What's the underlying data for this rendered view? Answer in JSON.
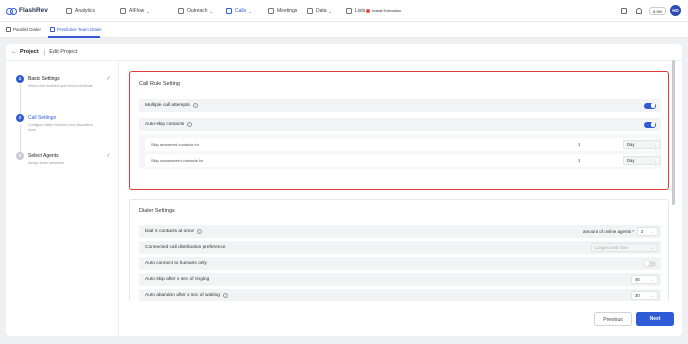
{
  "app": {
    "name": "FlashRev"
  },
  "nav": {
    "items": [
      {
        "label": "Analytics",
        "icon": "analytics-icon"
      },
      {
        "label": "AIFlow",
        "icon": "aiflow-icon"
      },
      {
        "label": "Outreach",
        "icon": "outreach-icon"
      },
      {
        "label": "Calls",
        "icon": "phone-icon"
      },
      {
        "label": "Meetings",
        "icon": "meetings-icon"
      },
      {
        "label": "Data",
        "icon": "data-icon"
      },
      {
        "label": "Lists",
        "icon": "lists-icon"
      }
    ],
    "install_label": "Install Extension",
    "balance": "8.9M",
    "avatar_initials": "HD"
  },
  "subtabs": [
    {
      "label": "Parallel Dialer"
    },
    {
      "label": "Predictive Team Dialer"
    }
  ],
  "header": {
    "back_label": "Project",
    "edit_label": "Edit Project"
  },
  "steps": [
    {
      "num": "1",
      "title": "Basic Settings",
      "desc": "Select dial numbers and select shortcuts"
    },
    {
      "num": "2",
      "title": "Call Settings",
      "desc": "Configure dialer behavior and disposition rules"
    },
    {
      "num": "3",
      "title": "Select Agents",
      "desc": "Assign team members"
    }
  ],
  "call_rule": {
    "title": "Call Rule Setting",
    "multiple_attempts_label": "Multiple call attempts",
    "multiple_attempts_on": true,
    "auto_skip_label": "Auto-skip contacts",
    "auto_skip_on": true,
    "skip_answered_label": "Skip answered contacts for",
    "skip_answered_value": "1",
    "skip_answered_unit": "Day",
    "skip_unanswered_label": "Skip unanswered contacts for",
    "skip_unanswered_value": "1",
    "skip_unanswered_unit": "Day"
  },
  "dialer": {
    "title": "Dialer Settings",
    "dial_x_label": "Dial X contacts at once",
    "agents_label": "amount of online agents *",
    "agents_value": "2",
    "distribution_label": "Connected call distribution preference",
    "distribution_value": "Longest wait time",
    "auto_connect_label": "Auto connect to humans only",
    "auto_connect_on": false,
    "auto_skip_ring_label": "Auto skip after x sec of ringing",
    "auto_skip_ring_value": "45",
    "auto_abandon_label": "Auto abandon after x sec of waiting",
    "auto_abandon_value": "30"
  },
  "footer": {
    "previous_label": "Previous",
    "next_label": "Next"
  }
}
